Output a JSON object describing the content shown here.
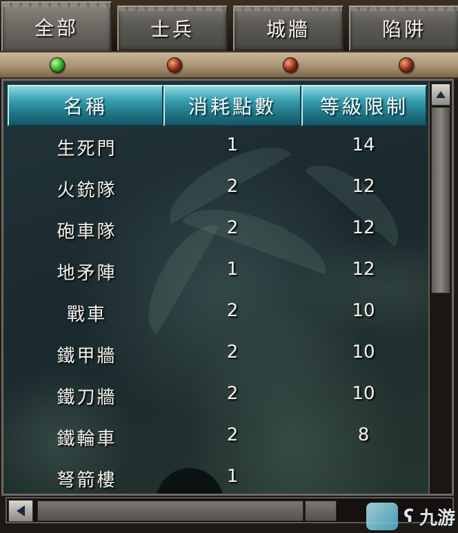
{
  "tabs": [
    {
      "label": "全部",
      "active": true
    },
    {
      "label": "士兵",
      "active": false
    },
    {
      "label": "城牆",
      "active": false
    },
    {
      "label": "陷阱",
      "active": false
    }
  ],
  "indicators": [
    "green",
    "red",
    "red",
    "red"
  ],
  "table": {
    "headers": [
      "名稱",
      "消耗點數",
      "等級限制"
    ],
    "rows": [
      [
        "生死門",
        "1",
        "14"
      ],
      [
        "火銃隊",
        "2",
        "12"
      ],
      [
        "砲車隊",
        "2",
        "12"
      ],
      [
        "地矛陣",
        "1",
        "12"
      ],
      [
        "戰車",
        "2",
        "10"
      ],
      [
        "鐵甲牆",
        "2",
        "10"
      ],
      [
        "鐵刀牆",
        "2",
        "10"
      ],
      [
        "鐵輪車",
        "2",
        "8"
      ],
      [
        "弩箭樓",
        "1",
        ""
      ]
    ]
  },
  "watermark": {
    "text": "九游"
  },
  "colors": {
    "header": "#1f7585",
    "indicator_active": "#2fa52a",
    "indicator_inactive": "#8a2a12"
  }
}
